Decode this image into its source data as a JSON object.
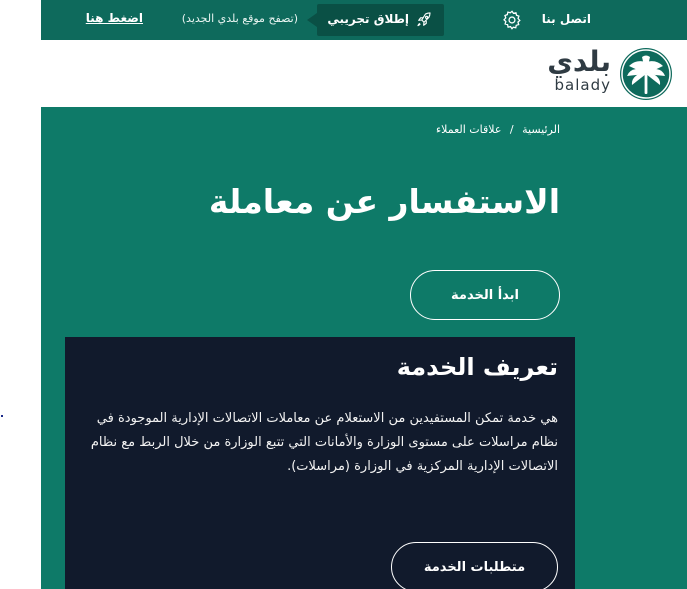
{
  "topbar": {
    "contact_label": "اتصل بنا",
    "settings_icon": "gear-icon",
    "beta_icon": "rocket-icon",
    "beta_label": "إطلاق تجريبي",
    "beta_note": "(تصفح موقع بلدي الجديد)",
    "click_here": "اضغط هنا"
  },
  "logo": {
    "name_ar": "بلدي",
    "name_en": "balady",
    "icon": "palm-logo-icon"
  },
  "breadcrumb": {
    "home": "الرئيسية",
    "separator": "/",
    "current": "علاقات العملاء"
  },
  "page": {
    "title": "الاستفسار عن معاملة",
    "start_button": "ابدأ الخدمة"
  },
  "service_card": {
    "title": "تعريف الخدمة",
    "description": "هي خدمة تمكن المستفيدين من الاستعلام عن معاملات الاتصالات الإدارية الموجودة في نظام مراسلات على مستوى الوزارة والأمانات التي تتبع الوزارة من خلال الربط مع نظام الاتصالات الإدارية المركزية في الوزارة (مراسلات).",
    "requirements_button": "متطلبات الخدمة"
  },
  "colors": {
    "topbar": "#0e6a5c",
    "hero": "#0e7a68",
    "card": "#111a2c"
  }
}
